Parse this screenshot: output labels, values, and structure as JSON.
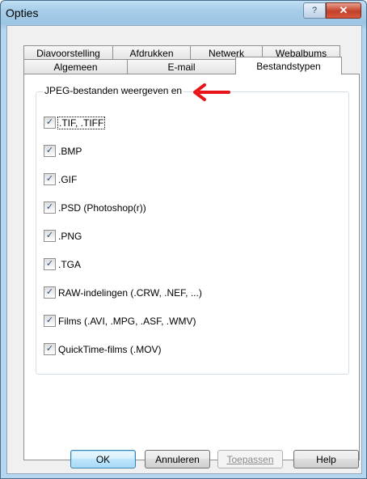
{
  "window": {
    "title": "Opties",
    "help_glyph": "?",
    "close_glyph": "✕"
  },
  "tabs": {
    "row1": [
      "Diavoorstelling",
      "Afdrukken",
      "Netwerk",
      "Webalbums"
    ],
    "row2": [
      "Algemeen",
      "E-mail",
      "Bestandstypen"
    ],
    "active": "Bestandstypen"
  },
  "group": {
    "legend": "JPEG-bestanden weergeven en",
    "arrow_color": "#e8141a",
    "items": [
      {
        "label": ".TIF, .TIFF",
        "checked": true
      },
      {
        "label": ".BMP",
        "checked": true
      },
      {
        "label": ".GIF",
        "checked": true
      },
      {
        "label": ".PSD (Photoshop(r))",
        "checked": true
      },
      {
        "label": ".PNG",
        "checked": true
      },
      {
        "label": ".TGA",
        "checked": true
      },
      {
        "label": "RAW-indelingen (.CRW, .NEF, ...)",
        "checked": true
      },
      {
        "label": "Films (.AVI, .MPG, .ASF, .WMV)",
        "checked": true
      },
      {
        "label": "QuickTime-films (.MOV)",
        "checked": true
      }
    ]
  },
  "buttons": {
    "ok": "OK",
    "cancel": "Annuleren",
    "apply": "Toepassen",
    "help": "Help"
  },
  "check_glyph": "✓"
}
